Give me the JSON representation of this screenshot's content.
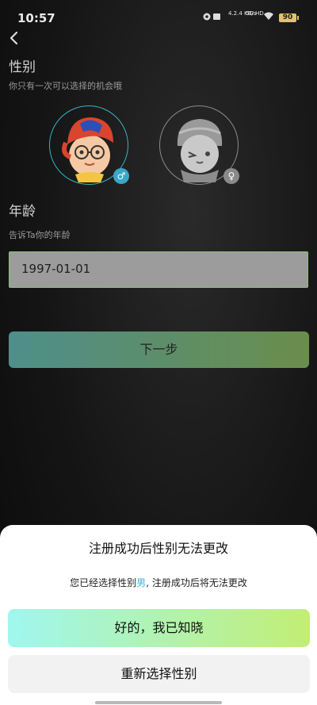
{
  "status_bar": {
    "time": "10:57",
    "net_speed": "4.2.4 KB/s",
    "signal_label": "5G HD",
    "battery": "90"
  },
  "gender_section": {
    "title": "性别",
    "subtitle": "你只有一次可以选择的机会哦",
    "selected": "male"
  },
  "age_section": {
    "title": "年龄",
    "subtitle": "告诉Ta你的年龄",
    "birthdate": "1997-01-01"
  },
  "next_button": "下一步",
  "dialog": {
    "title": "注册成功后性别无法更改",
    "message_prefix": "您已经选择性别",
    "message_gender": "男",
    "message_suffix": ", 注册成功后将无法更改",
    "confirm_label": "好的，我已知晓",
    "reselect_label": "重新选择性别"
  },
  "colors": {
    "accent_cyan": "#39b8d8",
    "confirm_gradient_start": "#9ff7ef",
    "confirm_gradient_end": "#c2ee74"
  },
  "icons": [
    "back-arrow-icon",
    "male-symbol-icon",
    "female-symbol-icon",
    "wifi-icon",
    "battery-icon"
  ]
}
